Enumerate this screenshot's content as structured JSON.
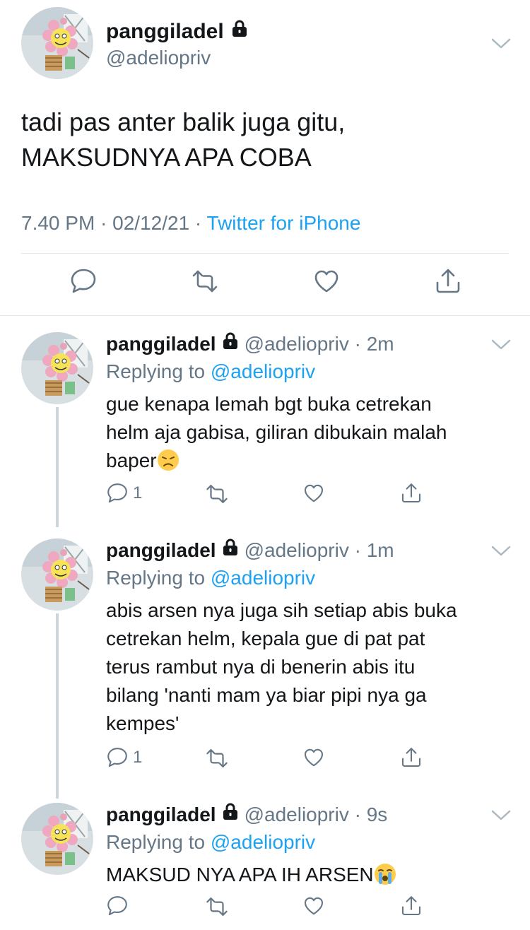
{
  "main_tweet": {
    "display_name": "panggiladel",
    "handle": "@adeliopriv",
    "text_lines": [
      "tadi pas anter balik juga gitu,",
      "MAKSUDNYA APA COBA"
    ],
    "timestamp": "7.40 PM · 02/12/21 · ",
    "source": "Twitter for iPhone"
  },
  "replies": [
    {
      "display_name": "panggiladel",
      "handle": "@adeliopriv · 2m",
      "replying_prefix": "Replying to ",
      "replying_to": "@adeliopriv",
      "text_lines": [
        "gue kenapa lemah bgt buka cetrekan",
        "helm aja gabisa, giliran dibukain malah",
        "baper"
      ],
      "emoji": "disappointed-face",
      "reply_count": "1"
    },
    {
      "display_name": "panggiladel",
      "handle": "@adeliopriv · 1m",
      "replying_prefix": "Replying to ",
      "replying_to": "@adeliopriv",
      "text_lines": [
        "abis arsen nya juga sih setiap abis buka",
        "cetrekan helm, kepala gue di pat pat",
        "terus rambut nya di benerin abis itu",
        "bilang 'nanti mam ya biar pipi nya ga",
        "kempes'"
      ],
      "reply_count": "1"
    },
    {
      "display_name": "panggiladel",
      "handle": "@adeliopriv · 9s",
      "replying_prefix": "Replying to ",
      "replying_to": "@adeliopriv",
      "text_lines": [
        "MAKSUD NYA APA IH ARSEN"
      ],
      "emoji": "loudly-crying-face",
      "reply_count": ""
    }
  ],
  "colors": {
    "text": "#14171a",
    "secondary": "#657786",
    "link": "#1da1f2",
    "divider": "#e1e8ed",
    "thread_line": "#ccd6dd"
  },
  "icons": [
    "lock-icon",
    "chevron-down-icon",
    "reply-icon",
    "retweet-icon",
    "like-icon",
    "share-icon"
  ]
}
